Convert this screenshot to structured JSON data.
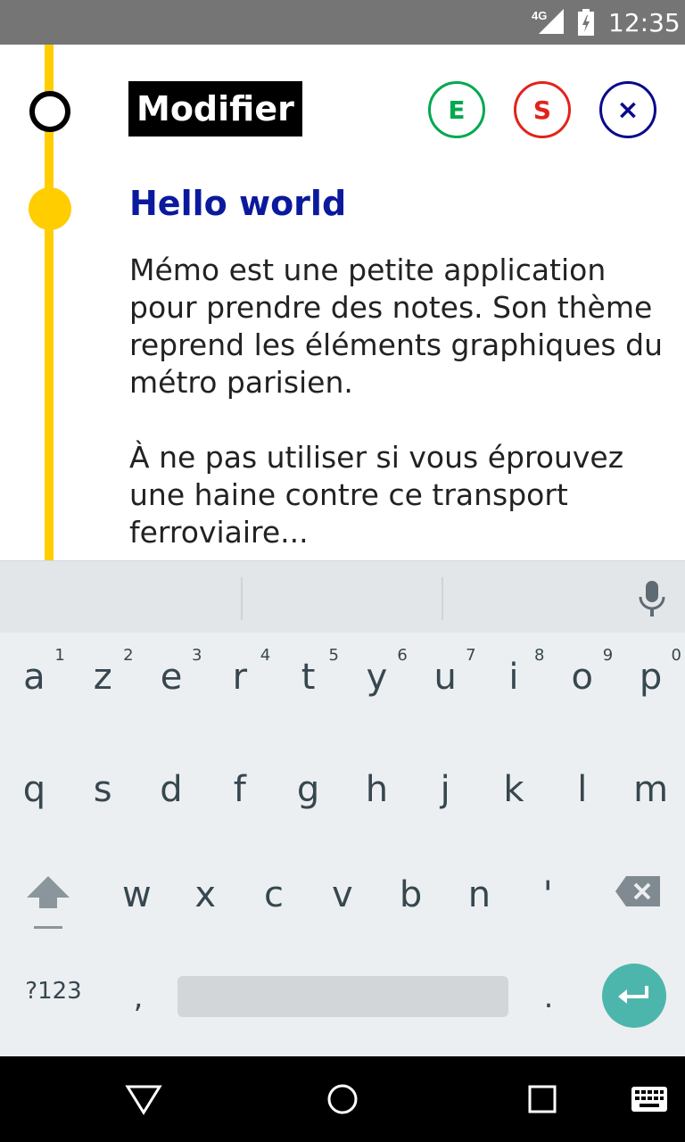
{
  "status_bar": {
    "network": "4G",
    "time": "12:35"
  },
  "header": {
    "edit_label": "Modifier",
    "buttons": {
      "e": "E",
      "s": "S",
      "close": "×"
    }
  },
  "note": {
    "title": "Hello world",
    "body": "Mémo est une petite application pour prendre des notes. Son thème reprend les éléments graphiques du métro parisien.\n\nÀ ne pas utiliser si vous éprouvez une haine contre ce transport ferroviaire..."
  },
  "keyboard": {
    "row1": [
      "a",
      "z",
      "e",
      "r",
      "t",
      "y",
      "u",
      "i",
      "o",
      "p"
    ],
    "row1_hints": [
      "1",
      "2",
      "3",
      "4",
      "5",
      "6",
      "7",
      "8",
      "9",
      "0"
    ],
    "row2": [
      "q",
      "s",
      "d",
      "f",
      "g",
      "h",
      "j",
      "k",
      "l",
      "m"
    ],
    "row3": [
      "w",
      "x",
      "c",
      "v",
      "b",
      "n",
      "'"
    ],
    "symbols_key": "?123",
    "comma_key": ",",
    "period_key": ".",
    "icons": [
      "mic-icon",
      "shift-icon",
      "backspace-icon",
      "enter-icon"
    ]
  },
  "colors": {
    "line_yellow": "#ffcd00",
    "title_blue": "#0b1a9c",
    "btn_green": "#00a94f",
    "btn_red": "#e2231a",
    "btn_navy": "#0a0a8c",
    "enter_teal": "#4db6ac"
  },
  "nav_bar": {
    "icons": [
      "back-icon",
      "home-icon",
      "recents-icon",
      "keyboard-switch-icon"
    ]
  }
}
